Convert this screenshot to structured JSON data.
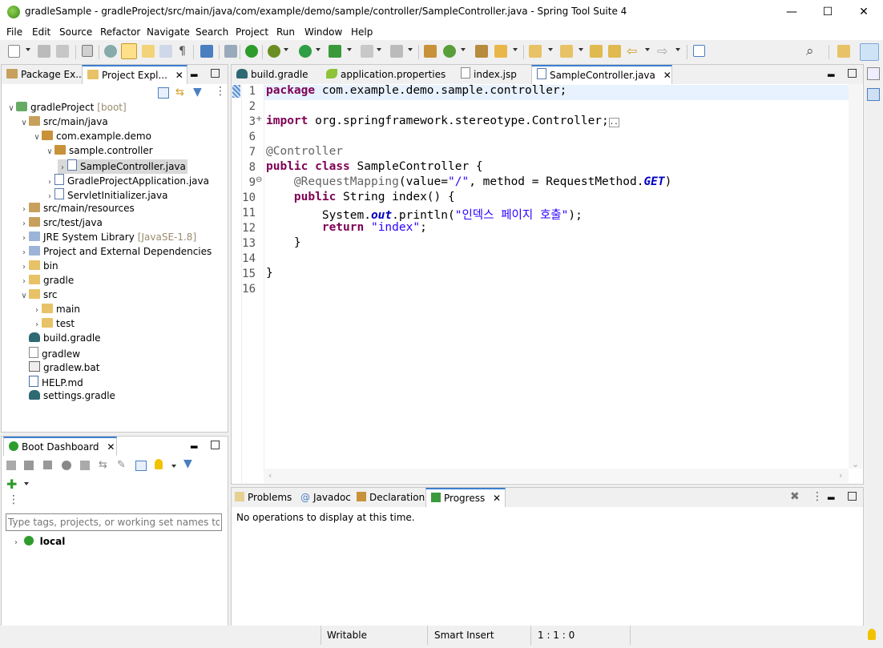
{
  "window": {
    "title": "gradleSample - gradleProject/src/main/java/com/example/demo/sample/controller/SampleController.java - Spring Tool Suite 4",
    "minimize": "—",
    "maximize": "☐",
    "close": "✕"
  },
  "menu": [
    "File",
    "Edit",
    "Source",
    "Refactor",
    "Navigate",
    "Search",
    "Project",
    "Run",
    "Window",
    "Help"
  ],
  "explorer": {
    "tabs": [
      {
        "label": "Package Ex..."
      },
      {
        "label": "Project Expl...",
        "close": "✕"
      }
    ],
    "tree": [
      {
        "indent": 0,
        "arrow": "∨",
        "icon": "proj",
        "label": "gradleProject",
        "extra": "[boot]"
      },
      {
        "indent": 1,
        "arrow": "∨",
        "icon": "pkgroot",
        "label": "src/main/java",
        "extra": ""
      },
      {
        "indent": 2,
        "arrow": "∨",
        "icon": "pkg",
        "label": "com.example.demo",
        "extra": ""
      },
      {
        "indent": 3,
        "arrow": "∨",
        "icon": "pkg",
        "label": "sample.controller",
        "extra": ""
      },
      {
        "indent": 4,
        "arrow": "›",
        "icon": "java",
        "label": "SampleController.java",
        "extra": "",
        "selected": true
      },
      {
        "indent": 3,
        "arrow": "›",
        "icon": "java",
        "label": "GradleProjectApplication.java",
        "extra": ""
      },
      {
        "indent": 3,
        "arrow": "›",
        "icon": "java",
        "label": "ServletInitializer.java",
        "extra": ""
      },
      {
        "indent": 1,
        "arrow": "›",
        "icon": "pkgroot",
        "label": "src/main/resources",
        "extra": ""
      },
      {
        "indent": 1,
        "arrow": "›",
        "icon": "pkgroot",
        "label": "src/test/java",
        "extra": ""
      },
      {
        "indent": 1,
        "arrow": "›",
        "icon": "lib",
        "label": "JRE System Library",
        "extra": "[JavaSE-1.8]"
      },
      {
        "indent": 1,
        "arrow": "›",
        "icon": "lib",
        "label": "Project and External Dependencies",
        "extra": ""
      },
      {
        "indent": 1,
        "arrow": "›",
        "icon": "folder",
        "label": "bin",
        "extra": ""
      },
      {
        "indent": 1,
        "arrow": "›",
        "icon": "folder",
        "label": "gradle",
        "extra": ""
      },
      {
        "indent": 1,
        "arrow": "∨",
        "icon": "folder",
        "label": "src",
        "extra": ""
      },
      {
        "indent": 2,
        "arrow": "›",
        "icon": "folder",
        "label": "main",
        "extra": ""
      },
      {
        "indent": 2,
        "arrow": "›",
        "icon": "folder",
        "label": "test",
        "extra": ""
      },
      {
        "indent": 1,
        "arrow": "",
        "icon": "gradle",
        "label": "build.gradle",
        "extra": ""
      },
      {
        "indent": 1,
        "arrow": "",
        "icon": "file",
        "label": "gradlew",
        "extra": ""
      },
      {
        "indent": 1,
        "arrow": "",
        "icon": "bat",
        "label": "gradlew.bat",
        "extra": ""
      },
      {
        "indent": 1,
        "arrow": "",
        "icon": "md",
        "label": "HELP.md",
        "extra": ""
      },
      {
        "indent": 1,
        "arrow": "",
        "icon": "gradle",
        "label": "settings.gradle",
        "extra": ""
      }
    ]
  },
  "editor": {
    "tabs": [
      {
        "label": "build.gradle"
      },
      {
        "label": "application.properties"
      },
      {
        "label": "index.jsp"
      },
      {
        "label": "SampleController.java",
        "close": "✕"
      }
    ],
    "lines": [
      {
        "n": "1",
        "html": "<span class='kw'>package</span> com.example.demo.sample.controller;"
      },
      {
        "n": "2",
        "html": ""
      },
      {
        "n": "3",
        "html": "<span class='kw'>import</span> org.springframework.stereotype.Controller;<span style='border:1px solid #999;font-size:9px'>..</span>",
        "mark": "+"
      },
      {
        "n": "6",
        "html": ""
      },
      {
        "n": "7",
        "html": "<span class='ann'>@Controller</span>"
      },
      {
        "n": "8",
        "html": "<span class='kw'>public</span> <span class='kw'>class</span> SampleController {"
      },
      {
        "n": "9",
        "html": "    <span class='ann'>@RequestMapping</span>(value=<span class='str'>\"/\"</span>, method = RequestMethod.<span class='fld'>GET</span>)",
        "mark": "⊖"
      },
      {
        "n": "10",
        "html": "    <span class='kw'>public</span> String index() {"
      },
      {
        "n": "11",
        "html": "        System.<span class='fld'>out</span>.println(<span class='str'>\"인덱스 페이지 호출\"</span>);"
      },
      {
        "n": "12",
        "html": "        <span class='kw'>return</span> <span class='str'>\"index\"</span>;"
      },
      {
        "n": "13",
        "html": "    }"
      },
      {
        "n": "14",
        "html": ""
      },
      {
        "n": "15",
        "html": "}"
      },
      {
        "n": "16",
        "html": ""
      }
    ]
  },
  "boot_dashboard": {
    "tab": "Boot Dashboard",
    "close": "✕",
    "filter_placeholder": "Type tags, projects, or working set names to mat",
    "local_label": "local"
  },
  "bottom_panel": {
    "tabs": [
      {
        "label": "Problems"
      },
      {
        "label": "Javadoc"
      },
      {
        "label": "Declaration"
      },
      {
        "label": "Progress",
        "close": "✕"
      }
    ],
    "message": "No operations to display at this time."
  },
  "status": {
    "writable": "Writable",
    "insert_mode": "Smart Insert",
    "position": "1 : 1 : 0"
  },
  "icons": {
    "min": "▂",
    "max": "□",
    "kebab": "⋮",
    "search": "⌕"
  }
}
